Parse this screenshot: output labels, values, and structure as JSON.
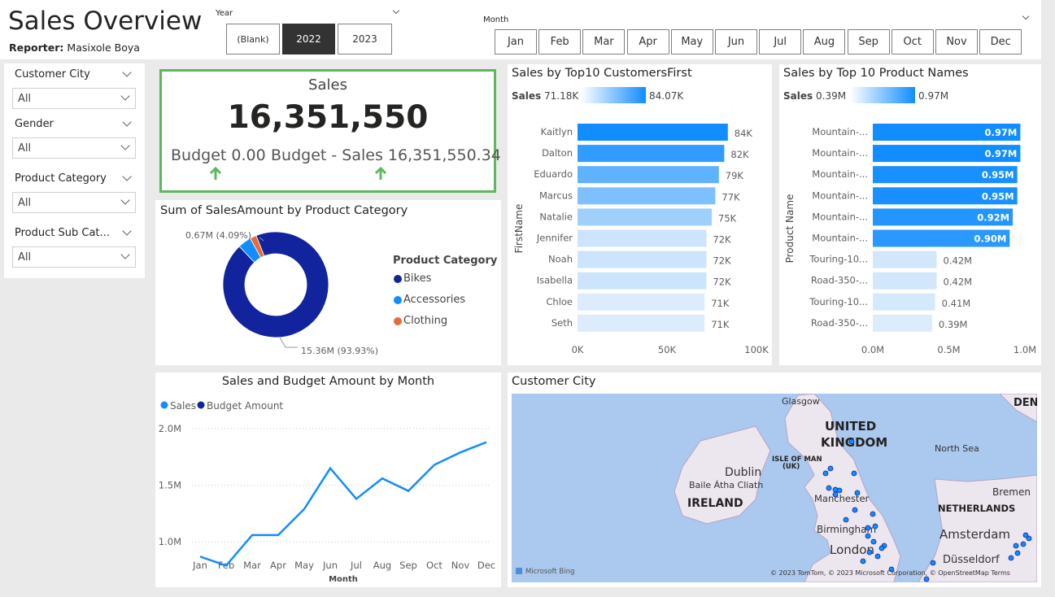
{
  "header": {
    "title": "Sales Overview",
    "reporter_label": "Reporter:",
    "reporter_name": "Masixole Boya"
  },
  "year_slicer": {
    "label": "Year",
    "options": [
      "(Blank)",
      "2022",
      "2023"
    ],
    "selected": "2022"
  },
  "month_slicer": {
    "label": "Month",
    "options": [
      "Jan",
      "Feb",
      "Mar",
      "Apr",
      "May",
      "Jun",
      "Jul",
      "Aug",
      "Sep",
      "Oct",
      "Nov",
      "Dec"
    ]
  },
  "filters": [
    {
      "label": "Customer City",
      "value": "All"
    },
    {
      "label": "Gender",
      "value": "All"
    },
    {
      "label": "Product Category",
      "value": "All"
    },
    {
      "label": "Product Sub Cat...",
      "value": "All"
    }
  ],
  "kpi": {
    "title": "Sales",
    "value": "16,351,550",
    "budget_label": "Budget 0.00",
    "diff_label": "Budget - Sales 16,351,550.34",
    "accent": "#5cb85c"
  },
  "donut": {
    "title": "Sum of SalesAmount by Product Category",
    "legend_title": "Product Category",
    "top_label": "0.67M (4.09%)",
    "bottom_label": "15.36M (93.93%)"
  },
  "top_customers": {
    "title": "Sales by Top10 CustomersFirst",
    "legend_label": "Sales",
    "legend_min": "71.18K",
    "legend_max": "84.07K",
    "axis_label": "FirstName"
  },
  "top_products": {
    "title": "Sales by Top 10 Product Names",
    "legend_label": "Sales",
    "legend_min": "0.39M",
    "legend_max": "0.97M",
    "axis_label": "Product Name"
  },
  "line": {
    "title": "Sales and Budget Amount by Month",
    "xlabel": "Month"
  },
  "map": {
    "title": "Customer City",
    "labels": [
      "Glasgow",
      "UNITED",
      "KINGDOM",
      "ISLE OF MAN",
      "(UK)",
      "Dublin",
      "Baile Átha Cliath",
      "IRELAND",
      "Manchester",
      "Birmingham",
      "London",
      "North Sea",
      "Bremen",
      "NETHERLANDS",
      "Amsterdam",
      "Düsseldorf",
      "DEN"
    ],
    "attribution": "© 2023 TomTom, © 2023 Microsoft Corporation, © OpenStreetMap  Terms",
    "bing": "Microsoft Bing"
  },
  "colors": {
    "bikes": "#12239e",
    "accessories": "#118dff",
    "clothing": "#e66c37",
    "bar_dark": "#118dff",
    "bar_light": "#dcecfc",
    "line_sales": "#118dff",
    "line_budget": "#12239e"
  },
  "chart_data": [
    {
      "type": "pie",
      "title": "Sum of SalesAmount by Product Category",
      "categories": [
        "Bikes",
        "Accessories",
        "Clothing"
      ],
      "values": [
        15.36,
        0.67,
        0.32
      ],
      "unit": "M"
    },
    {
      "type": "bar",
      "title": "Sales by Top10 CustomersFirst",
      "categories": [
        "Kaitlyn",
        "Dalton",
        "Eduardo",
        "Marcus",
        "Natalie",
        "Jennifer",
        "Noah",
        "Isabella",
        "Chloe",
        "Seth"
      ],
      "values": [
        84,
        82,
        79,
        77,
        75,
        72,
        72,
        72,
        71,
        71
      ],
      "value_labels": [
        "84K",
        "82K",
        "79K",
        "77K",
        "75K",
        "72K",
        "72K",
        "72K",
        "71K",
        "71K"
      ],
      "ylabel": "FirstName",
      "xlim": [
        0,
        100
      ],
      "x_ticks": [
        "0K",
        "50K",
        "100K"
      ]
    },
    {
      "type": "bar",
      "title": "Sales by Top 10 Product Names",
      "categories": [
        "Mountain-...",
        "Mountain-...",
        "Mountain-...",
        "Mountain-...",
        "Mountain-...",
        "Mountain-...",
        "Touring-10...",
        "Road-350-...",
        "Touring-10...",
        "Road-350-..."
      ],
      "values": [
        0.97,
        0.97,
        0.95,
        0.95,
        0.92,
        0.9,
        0.42,
        0.42,
        0.41,
        0.39
      ],
      "value_labels": [
        "0.97M",
        "0.97M",
        "0.95M",
        "0.95M",
        "0.92M",
        "0.90M",
        "0.42M",
        "0.42M",
        "0.41M",
        "0.39M"
      ],
      "ylabel": "Product Name",
      "xlim": [
        0,
        1.0
      ],
      "x_ticks": [
        "0.0M",
        "0.5M",
        "1.0M"
      ]
    },
    {
      "type": "line",
      "title": "Sales and Budget Amount by Month",
      "categories": [
        "Jan",
        "Feb",
        "Mar",
        "Apr",
        "May",
        "Jun",
        "Jul",
        "Aug",
        "Sep",
        "Oct",
        "Nov",
        "Dec"
      ],
      "series": [
        {
          "name": "Sales",
          "values": [
            0.87,
            0.79,
            1.06,
            1.06,
            1.29,
            1.65,
            1.38,
            1.56,
            1.45,
            1.68,
            1.79,
            1.88
          ]
        },
        {
          "name": "Budget Amount",
          "values": []
        }
      ],
      "xlabel": "Month",
      "ylim": [
        0.7,
        2.05
      ],
      "y_ticks": [
        "1.0M",
        "1.5M",
        "2.0M"
      ],
      "grid": true
    }
  ]
}
